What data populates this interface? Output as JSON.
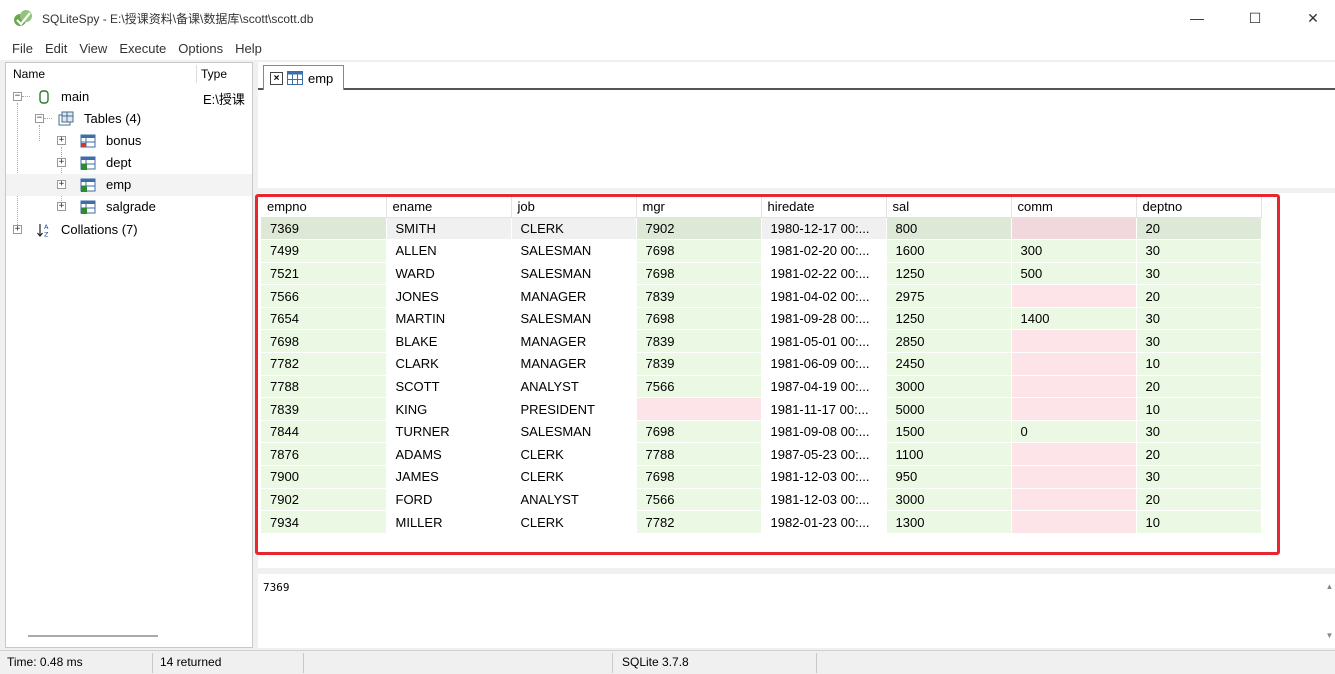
{
  "window": {
    "title": "SQLiteSpy - E:\\授课资料\\备课\\数据库\\scott\\scott.db",
    "minimize": "—",
    "maximize": "☐",
    "close": "✕"
  },
  "menu": [
    "File",
    "Edit",
    "View",
    "Execute",
    "Options",
    "Help"
  ],
  "tree": {
    "col_name": "Name",
    "col_type": "Type",
    "main_label": "main",
    "main_type": "E:\\授课",
    "tables_label": "Tables (4)",
    "tables": [
      "bonus",
      "dept",
      "emp",
      "salgrade"
    ],
    "collations_label": "Collations (7)",
    "selected": "emp"
  },
  "tab": {
    "label": "emp",
    "close": "×"
  },
  "grid": {
    "columns": [
      "empno",
      "ename",
      "job",
      "mgr",
      "hiredate",
      "sal",
      "comm",
      "deptno"
    ],
    "rows": [
      [
        "7369",
        "SMITH",
        "CLERK",
        "7902",
        "1980-12-17 00:...",
        "800",
        null,
        "20"
      ],
      [
        "7499",
        "ALLEN",
        "SALESMAN",
        "7698",
        "1981-02-20 00:...",
        "1600",
        "300",
        "30"
      ],
      [
        "7521",
        "WARD",
        "SALESMAN",
        "7698",
        "1981-02-22 00:...",
        "1250",
        "500",
        "30"
      ],
      [
        "7566",
        "JONES",
        "MANAGER",
        "7839",
        "1981-04-02 00:...",
        "2975",
        null,
        "20"
      ],
      [
        "7654",
        "MARTIN",
        "SALESMAN",
        "7698",
        "1981-09-28 00:...",
        "1250",
        "1400",
        "30"
      ],
      [
        "7698",
        "BLAKE",
        "MANAGER",
        "7839",
        "1981-05-01 00:...",
        "2850",
        null,
        "30"
      ],
      [
        "7782",
        "CLARK",
        "MANAGER",
        "7839",
        "1981-06-09 00:...",
        "2450",
        null,
        "10"
      ],
      [
        "7788",
        "SCOTT",
        "ANALYST",
        "7566",
        "1987-04-19 00:...",
        "3000",
        null,
        "20"
      ],
      [
        "7839",
        "KING",
        "PRESIDENT",
        null,
        "1981-11-17 00:...",
        "5000",
        null,
        "10"
      ],
      [
        "7844",
        "TURNER",
        "SALESMAN",
        "7698",
        "1981-09-08 00:...",
        "1500",
        "0",
        "30"
      ],
      [
        "7876",
        "ADAMS",
        "CLERK",
        "7788",
        "1987-05-23 00:...",
        "1100",
        null,
        "20"
      ],
      [
        "7900",
        "JAMES",
        "CLERK",
        "7698",
        "1981-12-03 00:...",
        "950",
        null,
        "30"
      ],
      [
        "7902",
        "FORD",
        "ANALYST",
        "7566",
        "1981-12-03 00:...",
        "3000",
        null,
        "20"
      ],
      [
        "7934",
        "MILLER",
        "CLERK",
        "7782",
        "1982-01-23 00:...",
        "1300",
        null,
        "10"
      ]
    ],
    "column_kinds": [
      "num",
      "txt",
      "txt",
      "num",
      "txt",
      "num",
      "num",
      "num"
    ]
  },
  "cell_viewer": {
    "value": "7369"
  },
  "status": {
    "time": "Time: 0.48 ms",
    "returned": "14 returned",
    "version": "SQLite 3.7.8"
  },
  "colors": {
    "numeric_cell": "#eaf8e4",
    "null_cell": "#fde4e8",
    "highlight_border": "#e8262e"
  }
}
